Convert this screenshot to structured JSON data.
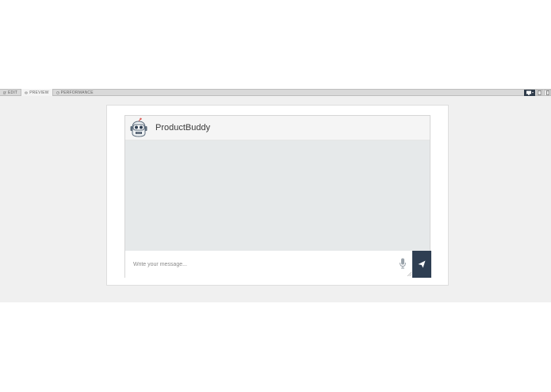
{
  "toolbar": {
    "tabs": [
      {
        "label": "EDIT",
        "icon": "edit-icon",
        "active": false
      },
      {
        "label": "PREVIEW",
        "icon": "eye-icon",
        "active": true
      },
      {
        "label": "PERFORMANCE",
        "icon": "gauge-icon",
        "active": false
      }
    ],
    "devices": [
      "desktop-icon",
      "tablet-icon",
      "mobile-icon"
    ]
  },
  "chat": {
    "bot_name": "ProductBuddy",
    "avatar_icon": "robot-avatar-icon",
    "input_placeholder": "Write your message...",
    "mic_icon": "microphone-icon",
    "send_icon": "send-icon"
  },
  "colors": {
    "send_button": "#2e3e52",
    "messages_bg": "#e6e9ea",
    "stage_bg": "#f0f0f0",
    "accent_red": "#d9534f"
  }
}
